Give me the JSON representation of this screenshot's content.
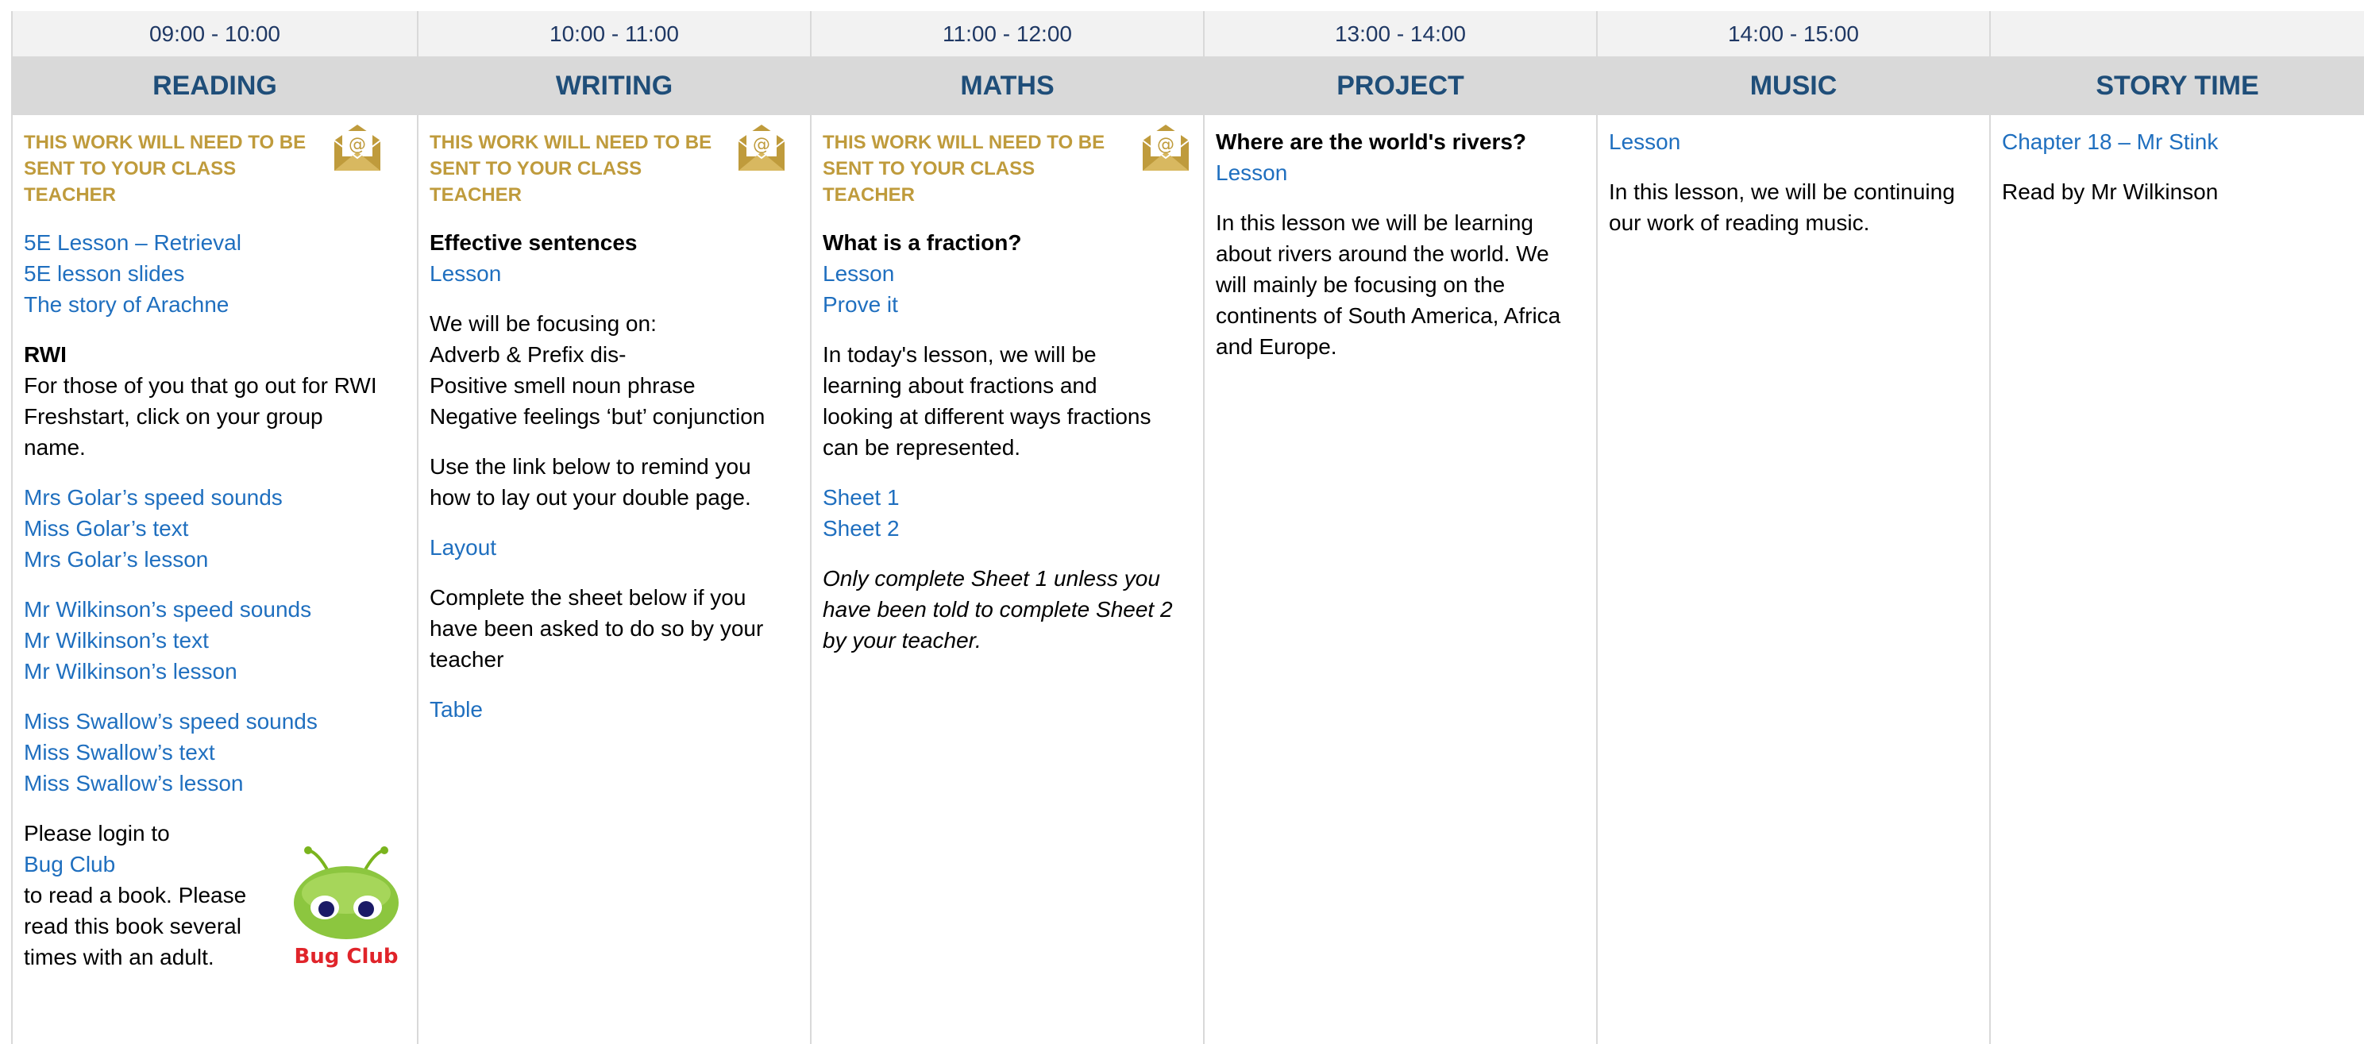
{
  "times": [
    "09:00 - 10:00",
    "10:00 - 11:00",
    "11:00 - 12:00",
    "13:00 - 14:00",
    "14:00 - 15:00",
    ""
  ],
  "subjects": [
    "READING",
    "WRITING",
    "MATHS",
    "PROJECT",
    "MUSIC",
    "STORY TIME"
  ],
  "note": {
    "line1": "THIS WORK WILL NEED TO BE",
    "line2": "SENT TO YOUR CLASS TEACHER"
  },
  "mail_icon_glyph": "@",
  "colors": {
    "link": "#1f6fbf",
    "note": "#bf9b3c",
    "subject": "#1f4e79",
    "header_bg": "#d9d9d9"
  },
  "reading": {
    "links_top": [
      "5E Lesson – Retrieval",
      "5E lesson slides",
      "The story of Arachne"
    ],
    "rwi_title": "RWI",
    "rwi_text": [
      "For those of you that go out for RWI",
      "Freshstart, click on your group",
      "name."
    ],
    "golar": [
      "Mrs Golar’s speed sounds",
      "Miss Golar’s text",
      "Mrs Golar’s lesson"
    ],
    "wilkinson": [
      "Mr Wilkinson’s speed sounds",
      "Mr Wilkinson’s text",
      "Mr Wilkinson’s lesson"
    ],
    "swallow": [
      "Miss Swallow’s speed sounds",
      "Miss Swallow’s text",
      "Miss Swallow’s lesson"
    ],
    "bug_pre": "Please login to ",
    "bug_link": "Bug Club",
    "bug_lines": [
      "to read a book. Please",
      "read this book several",
      "times with an adult."
    ],
    "bug_logo_text": "Bug Club"
  },
  "writing": {
    "title": "Effective sentences",
    "lesson_link": "Lesson",
    "focus": [
      "We will be focusing on:",
      "Adverb & Prefix dis-",
      "Positive smell noun phrase",
      "Negative feelings ‘but’ conjunction"
    ],
    "remind": [
      "Use the link below to remind you",
      "how to lay out your double page."
    ],
    "layout_link": "Layout",
    "sheet_text": [
      "Complete the sheet below if you",
      "have been asked to do so by your",
      "teacher"
    ],
    "table_link": "Table"
  },
  "maths": {
    "title": "What is a fraction?",
    "links": [
      "Lesson",
      "Prove it"
    ],
    "intro": [
      "In today's lesson, we will be",
      "learning about fractions and",
      "looking at different ways fractions",
      "can be represented."
    ],
    "sheets": [
      "Sheet 1",
      "Sheet 2"
    ],
    "italic": [
      "Only complete Sheet 1 unless you",
      "have been told to complete Sheet 2",
      "by your teacher."
    ]
  },
  "project": {
    "title": "Where are the world's rivers?",
    "lesson_link": "Lesson",
    "text": [
      "In this lesson we will be learning",
      "about rivers around the world. We",
      "will mainly be focusing on the",
      "continents of South America, Africa",
      "and Europe."
    ]
  },
  "music": {
    "lesson_link": "Lesson",
    "text": [
      "In this lesson, we will be continuing",
      "our work of reading music."
    ]
  },
  "story": {
    "chapter_link": "Chapter 18 – Mr Stink",
    "read_by": "Read by Mr Wilkinson"
  }
}
